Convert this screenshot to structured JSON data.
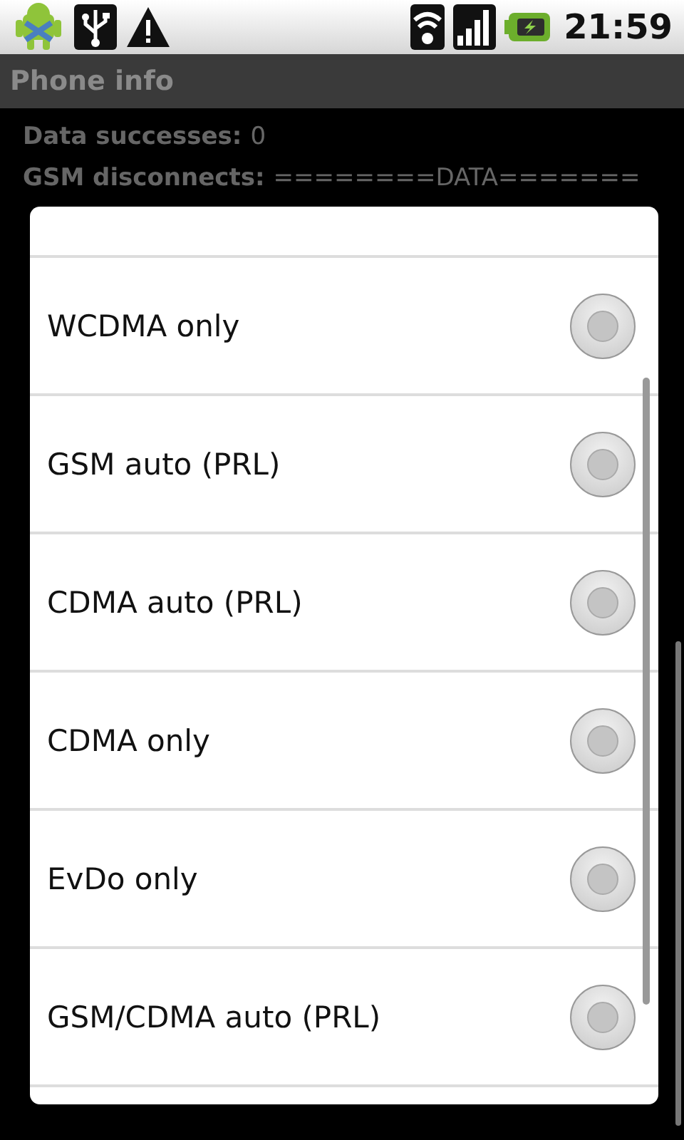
{
  "status_bar": {
    "time": "21:59"
  },
  "title_bar": {
    "title": "Phone info"
  },
  "background_info": [
    {
      "label": "Data successes:",
      "value": "0"
    },
    {
      "label": "GSM disconnects:",
      "value": "========DATA======="
    }
  ],
  "dialog": {
    "options": [
      {
        "label": "WCDMA only",
        "selected": false
      },
      {
        "label": "GSM auto (PRL)",
        "selected": false
      },
      {
        "label": "CDMA auto (PRL)",
        "selected": false
      },
      {
        "label": "CDMA only",
        "selected": false
      },
      {
        "label": "EvDo only",
        "selected": false
      },
      {
        "label": "GSM/CDMA auto (PRL)",
        "selected": false
      }
    ]
  }
}
